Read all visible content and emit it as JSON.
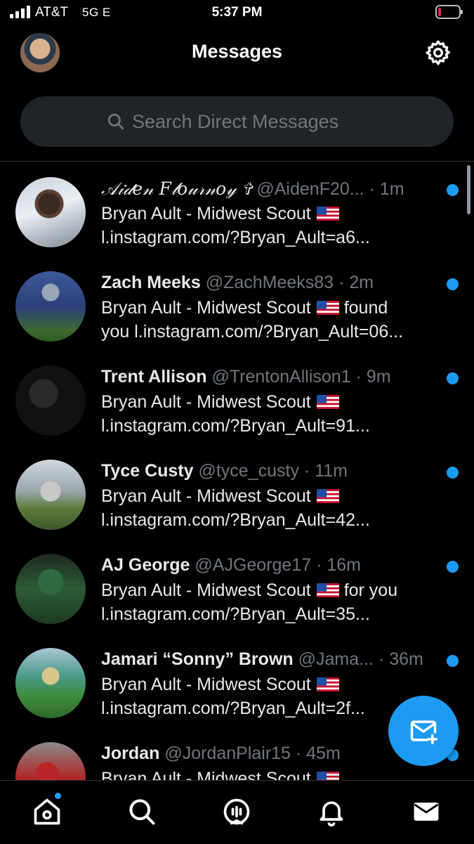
{
  "status_bar": {
    "carrier": "AT&T",
    "network": "5G E",
    "time": "5:37 PM",
    "battery_color": "#e0245e"
  },
  "header": {
    "title": "Messages",
    "avatar_icon": "profile-avatar",
    "settings_icon": "gear-icon"
  },
  "search": {
    "placeholder": "Search Direct Messages",
    "icon": "search-icon"
  },
  "conversations": [
    {
      "name": "𝒜𝒾𝒹𝑒𝓃 𝐹𝓁𝑜𝓊𝓇𝓃𝑜𝓎 ✞",
      "handle": "@AidenF20...",
      "time": "· 1m",
      "line2": "Bryan Ault - Midwest Scout",
      "line3": "l.instagram.com/?Bryan_Ault=a6...",
      "unread": true
    },
    {
      "name": "Zach Meeks",
      "handle": "@ZachMeeks83",
      "time": "· 2m",
      "line2": "Bryan Ault - Midwest Scout",
      "line2_suffix": "found",
      "line3": "you l.instagram.com/?Bryan_Ault=06...",
      "unread": true
    },
    {
      "name": "Trent Allison",
      "handle": "@TrentonAllison1",
      "time": "· 9m",
      "line2": "Bryan Ault - Midwest Scout",
      "line3": "l.instagram.com/?Bryan_Ault=91...",
      "unread": true
    },
    {
      "name": "Tyce Custy",
      "handle": "@tyce_custy",
      "time": "· 11m",
      "line2": "Bryan Ault - Midwest Scout",
      "line3": "l.instagram.com/?Bryan_Ault=42...",
      "unread": true
    },
    {
      "name": "AJ George",
      "handle": "@AJGeorge17",
      "time": "· 16m",
      "line2": "Bryan Ault - Midwest Scout",
      "line2_suffix": "for you",
      "line3": "l.instagram.com/?Bryan_Ault=35...",
      "unread": true
    },
    {
      "name": "Jamari “Sonny” Brown",
      "handle": "@Jama...",
      "time": "· 36m",
      "line2": "Bryan Ault - Midwest Scout",
      "line3": "l.instagram.com/?Bryan_Ault=2f...",
      "unread": true
    },
    {
      "name": "Jordan",
      "handle": "@JordanPlair15",
      "time": "· 45m",
      "line2": "Bryan Ault - Midwest Scout",
      "line3": "",
      "unread": true
    }
  ],
  "fab": {
    "icon": "new-message-icon"
  },
  "tabs": [
    {
      "icon": "home-icon",
      "active": false,
      "has_dot": true
    },
    {
      "icon": "search-icon",
      "active": false
    },
    {
      "icon": "spaces-icon",
      "active": false
    },
    {
      "icon": "bell-icon",
      "active": false
    },
    {
      "icon": "mail-icon",
      "active": true
    }
  ],
  "colors": {
    "accent": "#1d9bf0",
    "background": "#000000",
    "secondary_text": "#71767b"
  }
}
